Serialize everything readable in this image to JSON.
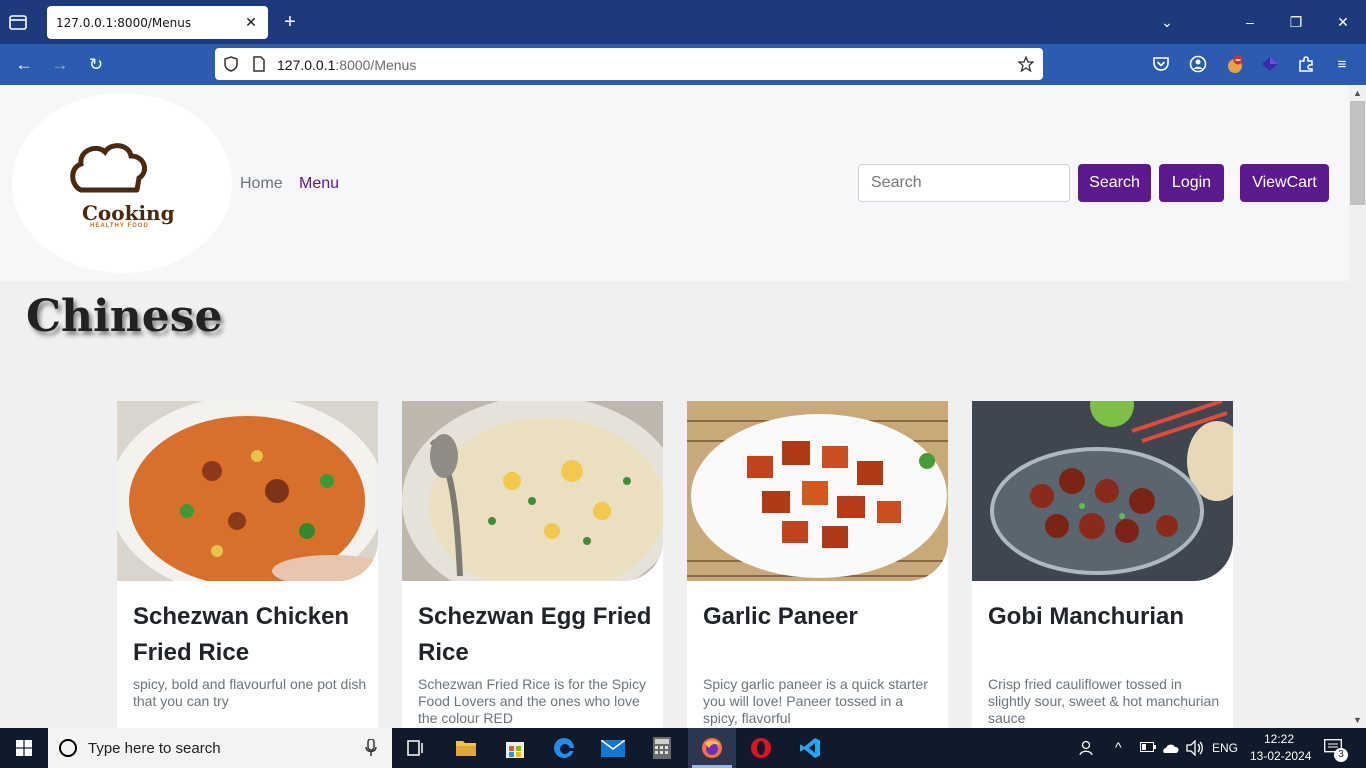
{
  "browser": {
    "tab_title": "127.0.0.1:8000/Menus",
    "url_host": "127.0.0.1",
    "url_path": ":8000/Menus"
  },
  "site": {
    "logo_text": "Cooking",
    "logo_subtext": "HEALTHY FOOD",
    "nav": {
      "home": "Home",
      "menu": "Menu"
    },
    "search_placeholder": "Search",
    "search_button": "Search",
    "login_button": "Login",
    "cart_button": "ViewCart",
    "accent_color": "#5c1a8c",
    "active_nav_color": "#5c1a8c"
  },
  "section": {
    "title": "Chinese"
  },
  "cards": [
    {
      "title": "Schezwan Chicken Fried Rice",
      "desc": "spicy, bold and flavourful one pot dish that you can try"
    },
    {
      "title": "Schezwan Egg Fried Rice",
      "desc": "Schezwan Fried Rice is for the Spicy Food Lovers and the ones who love the colour RED"
    },
    {
      "title": "Garlic Paneer",
      "desc": "Spicy garlic paneer is a quick starter you will love! Paneer tossed in a spicy, flavorful"
    },
    {
      "title": "Gobi Manchurian",
      "desc": "Crisp fried cauliflower tossed in slightly sour, sweet & hot manchurian sauce"
    }
  ],
  "taskbar": {
    "search_placeholder": "Type here to search",
    "language": "ENG",
    "time": "12:22",
    "date": "13-02-2024",
    "notification_count": "3"
  }
}
